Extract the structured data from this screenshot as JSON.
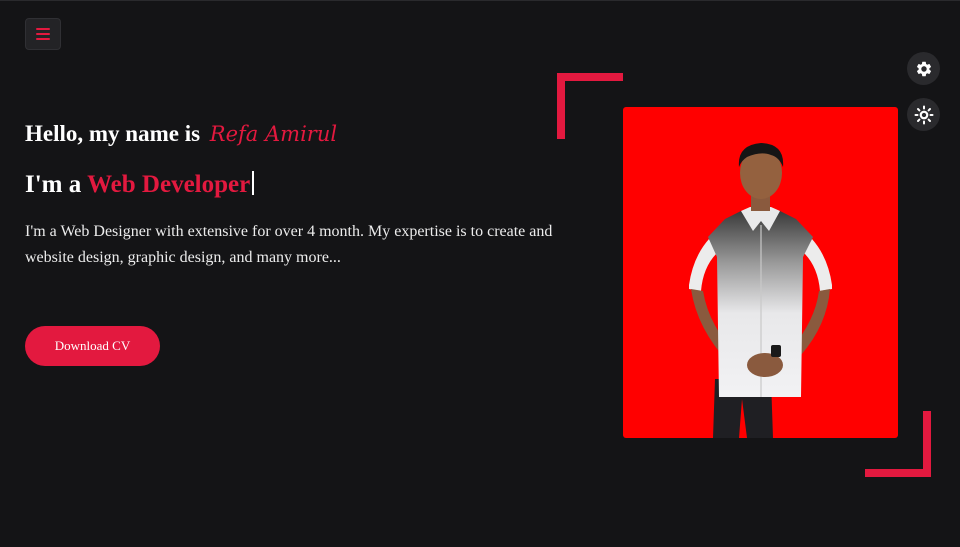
{
  "nav": {
    "menu_icon": "hamburger-menu-icon"
  },
  "controls": {
    "settings_icon": "gear-icon",
    "theme_icon": "sun-icon"
  },
  "hero": {
    "greeting": "Hello, my name is",
    "name": "Refa Amirul",
    "role_prefix": "I'm a",
    "role": "Web Developer",
    "description": "I'm a Web Designer with extensive for over 4 month. My expertise is to create and website design, graphic design, and many more...",
    "download_label": "Download CV"
  },
  "colors": {
    "background": "#141416",
    "accent": "#e3193f",
    "photo_background": "#ff0000"
  }
}
